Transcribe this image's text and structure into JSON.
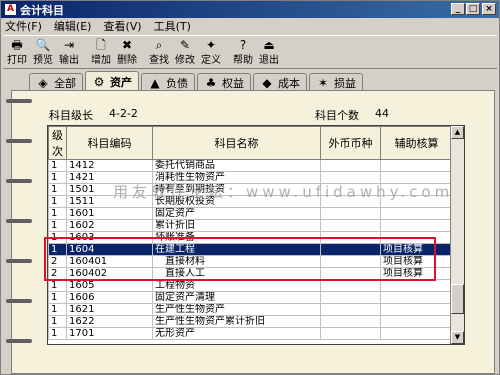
{
  "window": {
    "title": "会计科目"
  },
  "menu": [
    "文件(F)",
    "编辑(E)",
    "查看(V)",
    "工具(T)"
  ],
  "toolbar": [
    {
      "label": "打印",
      "icon": "printer-icon",
      "glyph": "🖶"
    },
    {
      "label": "预览",
      "icon": "preview-icon",
      "glyph": "🔍"
    },
    {
      "label": "输出",
      "icon": "export-icon",
      "glyph": "⇥"
    },
    {
      "label": "增加",
      "icon": "add-icon",
      "glyph": "🗋"
    },
    {
      "label": "删除",
      "icon": "delete-icon",
      "glyph": "✖"
    },
    {
      "label": "查找",
      "icon": "find-icon",
      "glyph": "⌕"
    },
    {
      "label": "修改",
      "icon": "edit-icon",
      "glyph": "✎"
    },
    {
      "label": "定义",
      "icon": "define-icon",
      "glyph": "✦"
    },
    {
      "label": "帮助",
      "icon": "help-icon",
      "glyph": "?"
    },
    {
      "label": "退出",
      "icon": "exit-icon",
      "glyph": "⏏"
    }
  ],
  "tabs": [
    {
      "label": "全部",
      "icon": "all-icon",
      "glyph": "◈",
      "active": false
    },
    {
      "label": "资产",
      "icon": "asset-icon",
      "glyph": "⚙",
      "active": true
    },
    {
      "label": "负债",
      "icon": "liability-icon",
      "glyph": "▲",
      "active": false
    },
    {
      "label": "权益",
      "icon": "equity-icon",
      "glyph": "♣",
      "active": false
    },
    {
      "label": "成本",
      "icon": "cost-icon",
      "glyph": "◆",
      "active": false
    },
    {
      "label": "损益",
      "icon": "profit-loss-icon",
      "glyph": "✶",
      "active": false
    }
  ],
  "info": {
    "level_label": "科目级长",
    "level_value": "4-2-2",
    "count_label": "科目个数",
    "count_value": "44"
  },
  "grid": {
    "headers": [
      "级次",
      "科目编码",
      "科目名称",
      "外币币种",
      "辅助核算"
    ],
    "rows": [
      [
        "1",
        "1412",
        "委托代销商品",
        "",
        ""
      ],
      [
        "1",
        "1421",
        "消耗性生物资产",
        "",
        ""
      ],
      [
        "1",
        "1501",
        "持有至到期投资",
        "",
        ""
      ],
      [
        "1",
        "1511",
        "长期股权投资",
        "",
        ""
      ],
      [
        "1",
        "1601",
        "固定资产",
        "",
        ""
      ],
      [
        "1",
        "1602",
        "累计折旧",
        "",
        ""
      ],
      [
        "1",
        "1603",
        "坏账准备",
        "",
        ""
      ],
      [
        "1",
        "1604",
        "在建工程",
        "",
        "项目核算"
      ],
      [
        "2",
        "160401",
        "　直接材料",
        "",
        "项目核算"
      ],
      [
        "2",
        "160402",
        "　直接人工",
        "",
        "项目核算"
      ],
      [
        "1",
        "1605",
        "工程物资",
        "",
        ""
      ],
      [
        "1",
        "1606",
        "固定资产清理",
        "",
        ""
      ],
      [
        "1",
        "1621",
        "生产性生物资产",
        "",
        ""
      ],
      [
        "1",
        "1622",
        "生产性生物资产累计折旧",
        "",
        ""
      ],
      [
        "1",
        "1701",
        "无形资产",
        "",
        ""
      ]
    ],
    "selected_row": 7
  },
  "watermark": "用友软件论坛：www.ufidawhy.com",
  "colors": {
    "selection": "#0a246a",
    "highlight_box": "#e0102a",
    "notebook": "#f5f1da"
  }
}
